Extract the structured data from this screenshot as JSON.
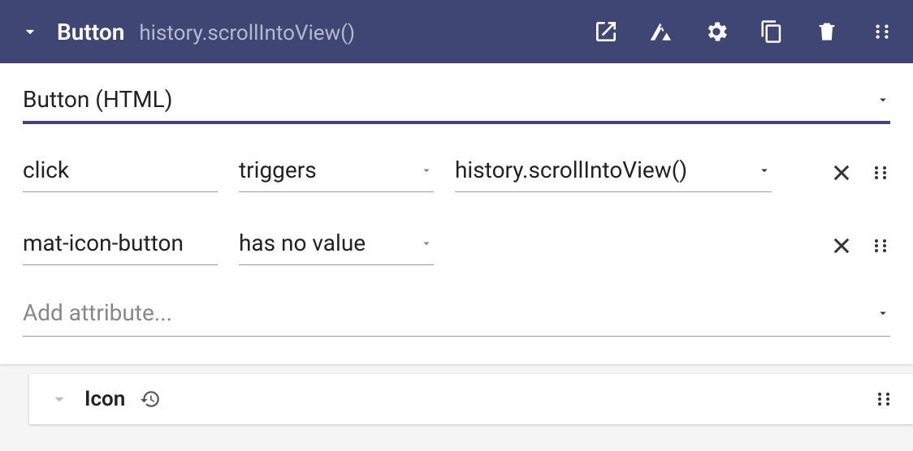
{
  "header": {
    "title": "Button",
    "subtitle": "history.scrollIntoView()"
  },
  "selector": {
    "label": "Button (HTML)"
  },
  "rows": [
    {
      "event": "click",
      "operator": "triggers",
      "target": "history.scrollIntoView()"
    },
    {
      "attribute": "mat-icon-button",
      "value_state": "has no value"
    }
  ],
  "add": {
    "placeholder": "Add attribute..."
  },
  "child": {
    "title": "Icon"
  }
}
